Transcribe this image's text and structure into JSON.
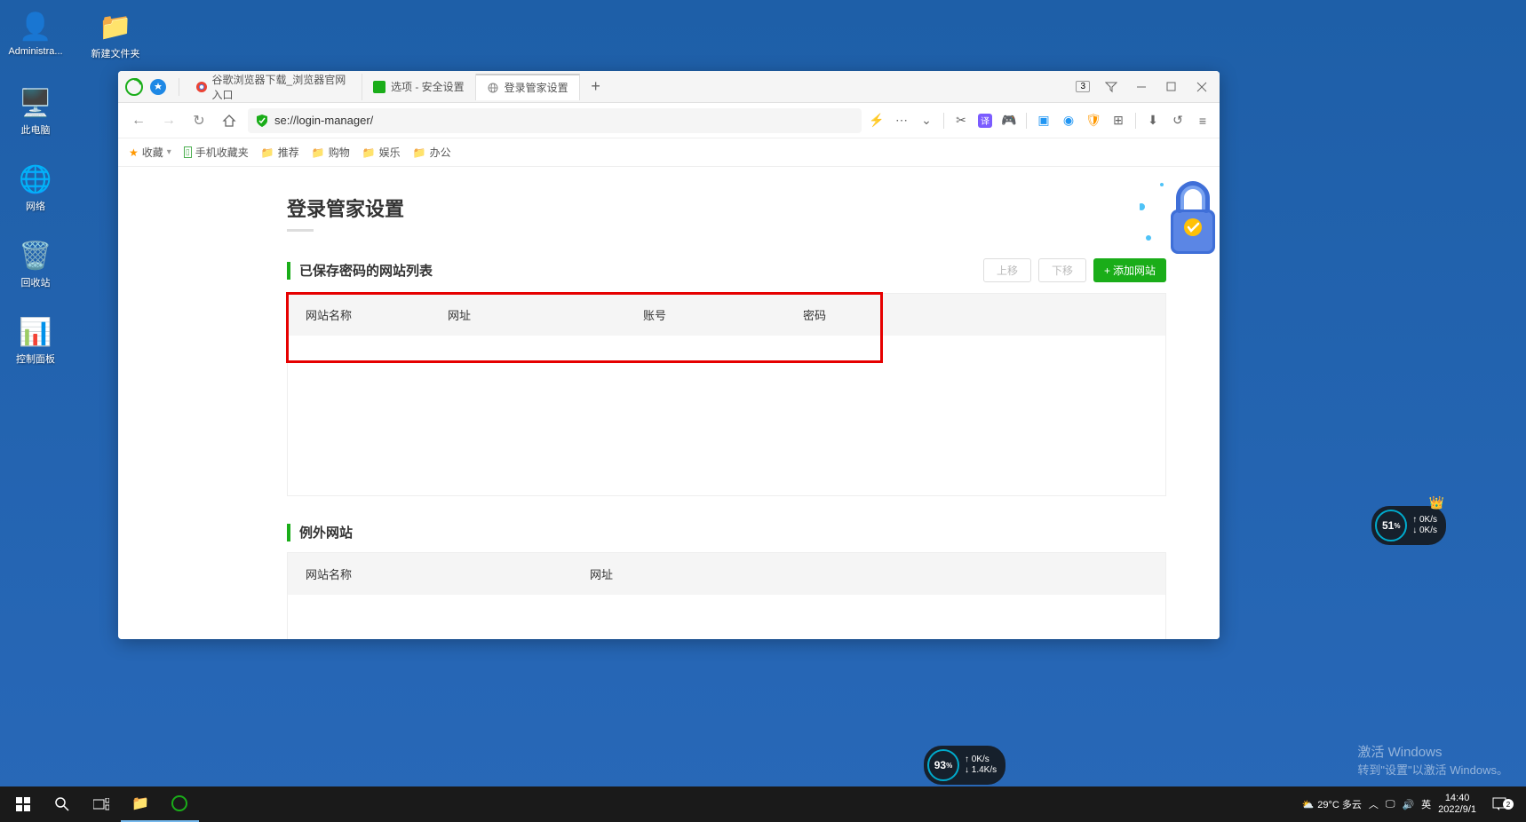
{
  "desktop": {
    "icons": [
      {
        "label": "Administra...",
        "glyph": "👤",
        "color": "#4caf50"
      },
      {
        "label": "新建文件夹",
        "glyph": "📁",
        "color": "#ffc107"
      },
      {
        "label": "此电脑",
        "glyph": "💻",
        "color": "#2196f3"
      },
      {
        "label": "网络",
        "glyph": "🌐",
        "color": "#2196f3"
      },
      {
        "label": "回收站",
        "glyph": "🗑️",
        "color": "#fff"
      },
      {
        "label": "控制面板",
        "glyph": "⚙️",
        "color": "#2196f3"
      }
    ]
  },
  "browser": {
    "tab_count": "3",
    "tabs": [
      {
        "title": "谷歌浏览器下载_浏览器官网入口",
        "favicon_color": "#ea4335"
      },
      {
        "title": "选项 - 安全设置",
        "favicon_color": "#1aad19"
      },
      {
        "title": "登录管家设置",
        "favicon_color": "#888",
        "active": true
      }
    ],
    "url": "se://login-manager/",
    "bookmarks": {
      "fav": "收藏",
      "phone": "手机收藏夹",
      "items": [
        "推荐",
        "购物",
        "娱乐",
        "办公"
      ]
    }
  },
  "page": {
    "title": "登录管家设置",
    "section1": {
      "title": "已保存密码的网站列表",
      "btn_up": "上移",
      "btn_down": "下移",
      "btn_add": "添加网站",
      "col_name": "网站名称",
      "col_url": "网址",
      "col_account": "账号",
      "col_password": "密码"
    },
    "section2": {
      "title": "例外网站",
      "col_name": "网站名称",
      "col_url": "网址"
    }
  },
  "widgets": {
    "w1": {
      "percent": "51",
      "unit": "%",
      "up": "0K/s",
      "down": "0K/s"
    },
    "w2": {
      "percent": "93",
      "unit": "%",
      "up": "0K/s",
      "down": "1.4K/s"
    }
  },
  "taskbar": {
    "weather": "29°C 多云",
    "ime": "英",
    "time": "14:40",
    "date": "2022/9/1",
    "notif_count": "2"
  },
  "watermark": {
    "line1": "激活 Windows",
    "line2": "转到\"设置\"以激活 Windows。"
  }
}
